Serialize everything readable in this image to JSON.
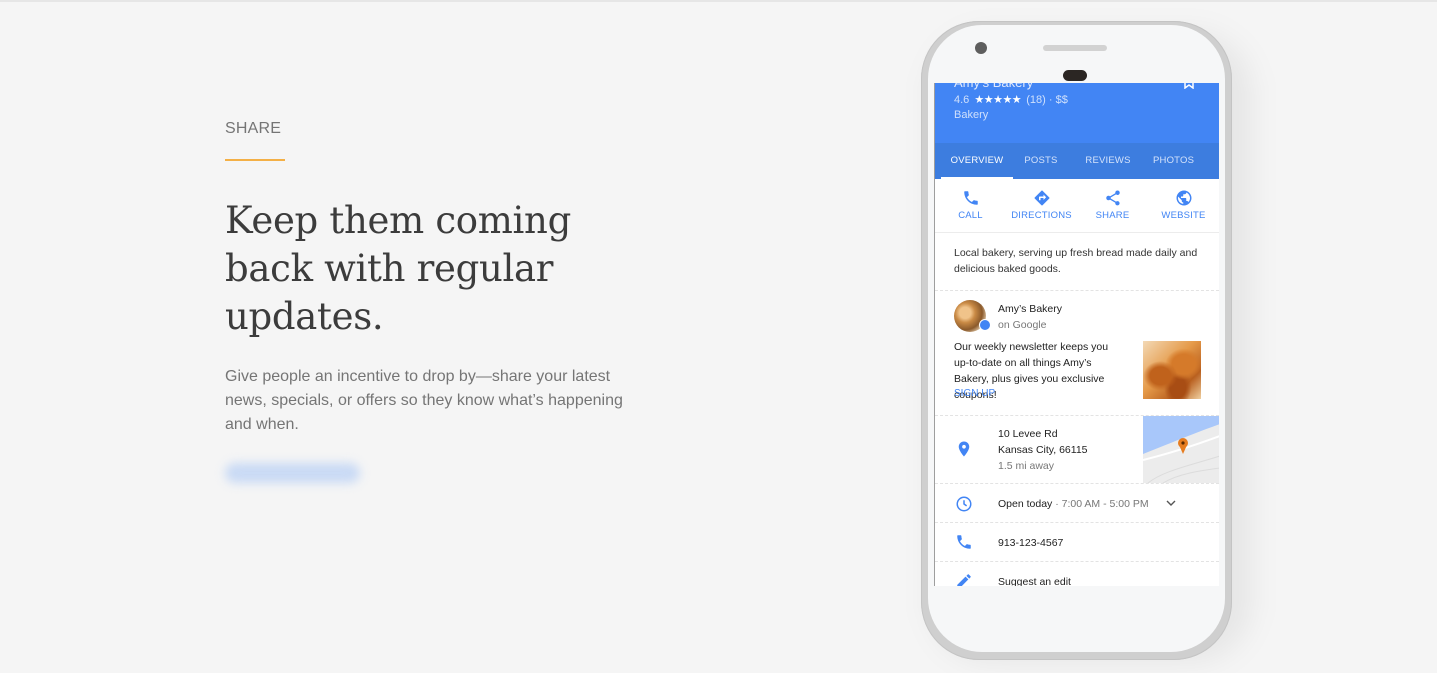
{
  "section": {
    "eyebrow": "SHARE",
    "headline": "Keep them coming back with regular updates.",
    "body": "Give people an incentive to drop by—share your latest news, specials, or offers so they know what’s happening and when.",
    "cta_label": ""
  },
  "colors": {
    "accent_rule": "#f4b046",
    "maps_blue": "#4285f4",
    "tabs_blue": "#3d7ddf",
    "map_pin": "#e67c1f"
  },
  "listing": {
    "name": "Amy’s Bakery",
    "rating": "4.6",
    "stars": "★★★★★",
    "review_count": "(18)",
    "price": "· $$",
    "category": "Bakery",
    "tabs": [
      {
        "label": "OVERVIEW",
        "active": true
      },
      {
        "label": "POSTS",
        "active": false
      },
      {
        "label": "REVIEWS",
        "active": false
      },
      {
        "label": "PHOTOS",
        "active": false
      }
    ],
    "actions": [
      {
        "label": "CALL",
        "icon": "phone-icon"
      },
      {
        "label": "DIRECTIONS",
        "icon": "directions-icon"
      },
      {
        "label": "SHARE",
        "icon": "share-icon"
      },
      {
        "label": "WEBSITE",
        "icon": "globe-icon"
      }
    ],
    "description": "Local bakery, serving up fresh bread made daily and delicious baked goods.",
    "post": {
      "author": "Amy’s Bakery",
      "source": "on Google",
      "text": "Our weekly newsletter keeps you up-to-date on all things Amy’s Bakery, plus gives you exclusive coupons!",
      "link": "SIGN UP"
    },
    "address": {
      "line1": "10 Levee Rd",
      "line2": "Kansas City, 66115",
      "distance": "1.5 mi away"
    },
    "hours": {
      "status": "Open today",
      "times": " · 7:00 AM - 5:00 PM"
    },
    "phone": "913-123-4567",
    "suggest_edit": "Suggest an edit"
  }
}
